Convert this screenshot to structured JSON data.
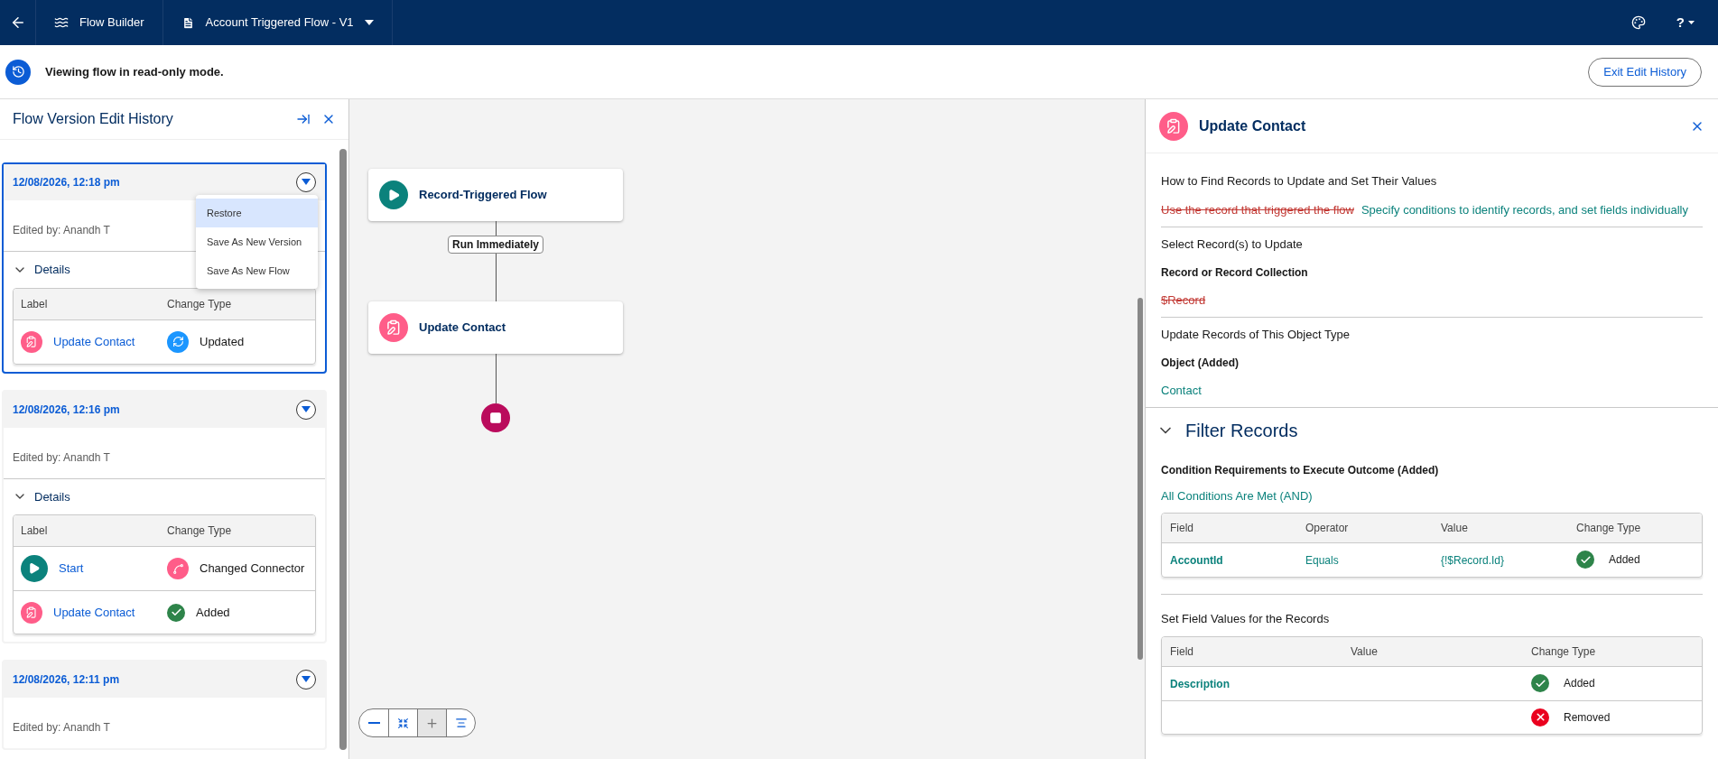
{
  "top_bar": {
    "app_name": "Flow Builder",
    "flow_title": "Account Triggered Flow - V1",
    "help_label": "?"
  },
  "banner": {
    "message": "Viewing flow in read-only mode.",
    "button": "Exit Edit History"
  },
  "history_panel": {
    "title": "Flow Version Edit History",
    "versions": [
      {
        "timestamp": "12/08/2026, 12:18 pm",
        "selected": true,
        "edited_by": "Edited by: Anandh T",
        "details_label": "Details",
        "expanded": true,
        "columns": [
          "Label",
          "Change Type"
        ],
        "rows": [
          {
            "element": {
              "kind": "update",
              "label": "Update Contact"
            },
            "kind": "updated",
            "change_type": "Updated"
          }
        ],
        "menu": [
          {
            "label": "Restore",
            "selected": true
          },
          {
            "label": "Save As New Version",
            "selected": false
          },
          {
            "label": "Save As New Flow",
            "selected": false
          }
        ]
      },
      {
        "timestamp": "12/08/2026, 12:16 pm",
        "selected": false,
        "edited_by": "Edited by: Anandh T",
        "details_label": "Details",
        "expanded": true,
        "columns": [
          "Label",
          "Change Type"
        ],
        "rows": [
          {
            "element": {
              "kind": "start",
              "label": "Start"
            },
            "kind": "connector",
            "change_type": "Changed Connector"
          },
          {
            "element": {
              "kind": "update",
              "label": "Update Contact"
            },
            "kind": "added",
            "change_type": "Added"
          }
        ]
      },
      {
        "timestamp": "12/08/2026, 12:11 pm",
        "selected": false,
        "edited_by": "Edited by: Anandh T"
      }
    ]
  },
  "canvas": {
    "nodes": [
      {
        "kind": "start",
        "label": "Record-Triggered Flow"
      },
      {
        "kind": "update",
        "label": "Update Contact"
      }
    ],
    "connector_label": "Run Immediately"
  },
  "details_panel": {
    "title": "Update Contact",
    "sections": [
      {
        "kind": "choice",
        "heading": "How to Find Records to Update and Set Their Values",
        "values": [
          {
            "kind": "removed",
            "text": "Use the record that triggered the flow"
          },
          {
            "kind": "added",
            "text": "Specify conditions to identify records, and set fields individually"
          }
        ]
      },
      {
        "kind": "field",
        "heading": "Select Record(s) to Update",
        "label": "Record or Record Collection",
        "values": [
          {
            "kind": "removed",
            "text": "$Record"
          }
        ]
      },
      {
        "kind": "field",
        "heading": "Update Records of This Object Type",
        "label": "Object (Added)",
        "values": [
          {
            "kind": "added",
            "text": "Contact"
          }
        ]
      }
    ],
    "filter": {
      "title": "Filter Records",
      "expanded": true,
      "label": "Condition Requirements to Execute Outcome (Added)",
      "logic": "All Conditions Are Met (AND)",
      "columns": [
        "Field",
        "Operator",
        "Value",
        "Change Type"
      ],
      "rows": [
        {
          "cells": [
            "AccountId",
            "Equals",
            "{!$Record.Id}"
          ],
          "kind": "added",
          "change_type": "Added"
        }
      ]
    },
    "field_values": {
      "heading": "Set Field Values for the Records",
      "columns": [
        "Field",
        "Value",
        "Change Type"
      ],
      "rows": [
        {
          "cells": [
            "Description",
            ""
          ],
          "kind": "added",
          "change_type": "Added"
        },
        {
          "cells": [
            "",
            ""
          ],
          "kind": "removed",
          "change_type": "Removed"
        }
      ]
    }
  }
}
